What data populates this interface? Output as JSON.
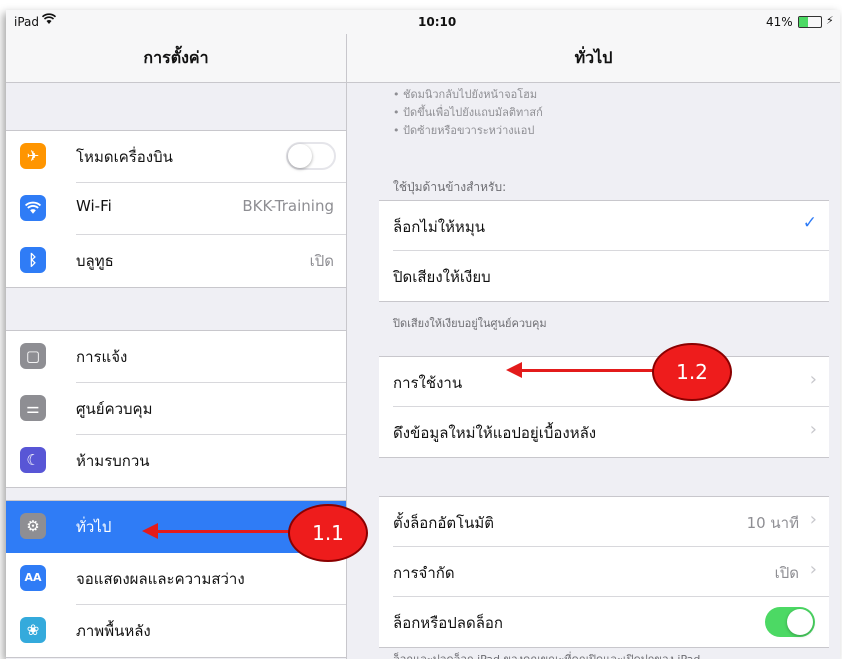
{
  "status_bar": {
    "carrier": "iPad",
    "wifi_icon": "wifi-icon",
    "time": "10:10",
    "battery_percent": "41%",
    "battery_level": 0.41
  },
  "sidebar": {
    "title": "การตั้งค่า",
    "groups": [
      {
        "items": [
          {
            "label": "โหมดเครื่องบิน",
            "icon": "airplane-icon",
            "icon_color": "#ff9500",
            "toggle": false
          },
          {
            "label": "Wi-Fi",
            "value": "BKK-Training",
            "icon": "wifi-icon",
            "icon_color": "#2f7cf6"
          },
          {
            "label": "บลูทูธ",
            "value": "เปิด",
            "icon": "bluetooth-icon",
            "icon_color": "#2f7cf6"
          }
        ]
      },
      {
        "items": [
          {
            "label": "การแจ้ง",
            "icon": "notifications-icon",
            "icon_color": "#8e8e93"
          },
          {
            "label": "ศูนย์ควบคุม",
            "icon": "control-center-icon",
            "icon_color": "#8e8e93"
          },
          {
            "label": "ห้ามรบกวน",
            "icon": "moon-icon",
            "icon_color": "#5856d6"
          }
        ]
      },
      {
        "items": [
          {
            "label": "ทั่วไป",
            "icon": "gear-icon",
            "icon_color": "#8e8e93",
            "selected": true
          },
          {
            "label": "จอแสดงผลและความสว่าง",
            "icon": "display-icon",
            "icon_color": "#2f7cf6",
            "icon_text": "AA"
          },
          {
            "label": "ภาพพื้นหลัง",
            "icon": "wallpaper-icon",
            "icon_color": "#34aadc"
          }
        ]
      }
    ]
  },
  "main": {
    "title": "ทั่วไป",
    "bullets": [
      "• ชัดมนิวกลับไปยังหน้าจอโฮม",
      "• ปัดขึ้นเพื่อไปยังแถบมัลติทาสก์",
      "• ปัดซ้ายหรือขวาระหว่างแอป"
    ],
    "side_switch_header": "ใช้ปุ่มด้านข้างสำหรับ:",
    "side_switch_options": [
      {
        "label": "ล็อกไม่ให้หมุน",
        "checked": true
      },
      {
        "label": "ปิดเสียงให้เงียบ",
        "checked": false
      }
    ],
    "side_switch_footer": "ปิดเสียงให้เงียบอยู่ในศูนย์ควบคุม",
    "usage_group": [
      {
        "label": "การใช้งาน"
      },
      {
        "label": "ดึงข้อมูลใหม่ให้แอปอยู่เบื้องหลัง"
      }
    ],
    "lock_group": [
      {
        "label": "ตั้งล็อกอัตโนมัติ",
        "value": "10 นาที"
      },
      {
        "label": "การจำกัด",
        "value": "เปิด"
      },
      {
        "label": "ล็อกหรือปลดล็อก",
        "toggle": true
      }
    ],
    "lock_footer": "ล็อกและปลดล็อก iPad ของคุณขณะที่คุณปิดและเปิดปกของ iPad"
  },
  "annotations": [
    {
      "label": "1.1"
    },
    {
      "label": "1.2"
    }
  ],
  "chevron": "›",
  "checkmark": "✓"
}
